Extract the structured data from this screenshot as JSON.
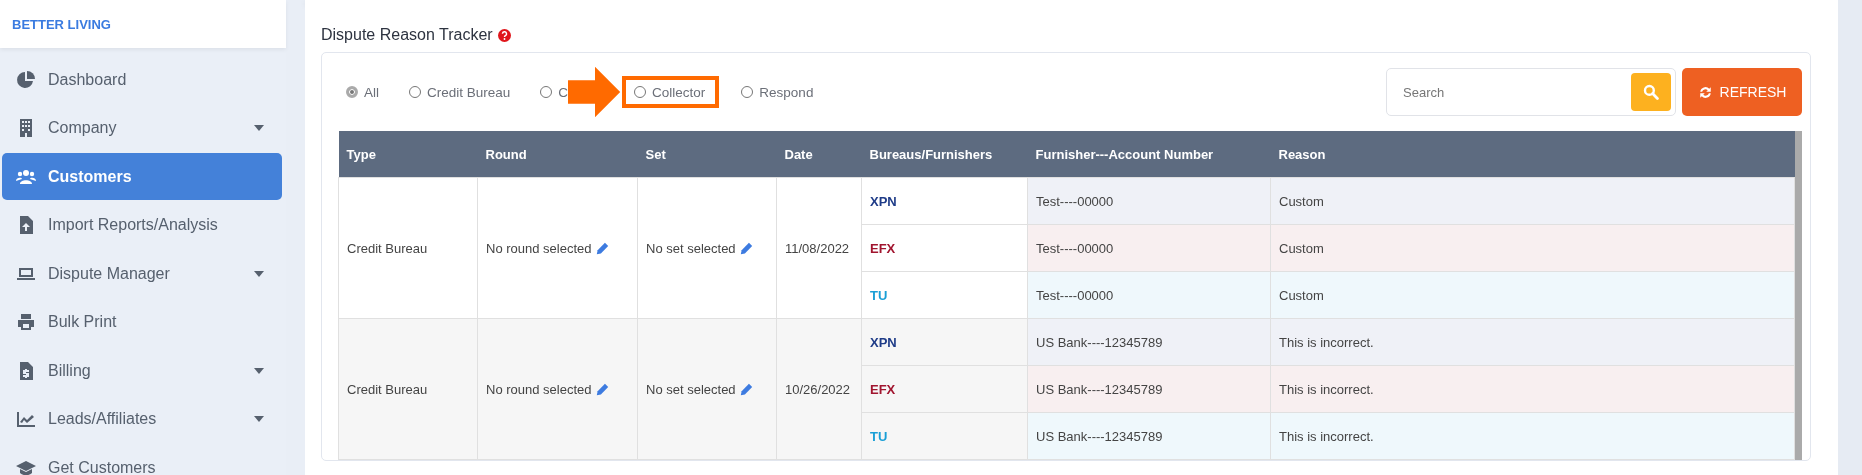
{
  "brand": "BETTER LIVING",
  "sidebar": {
    "items": [
      {
        "label": "Dashboard",
        "selected": false,
        "dropdown": false
      },
      {
        "label": "Company",
        "selected": false,
        "dropdown": true
      },
      {
        "label": "Customers",
        "selected": true,
        "dropdown": false
      },
      {
        "label": "Import Reports/Analysis",
        "selected": false,
        "dropdown": false
      },
      {
        "label": "Dispute Manager",
        "selected": false,
        "dropdown": true
      },
      {
        "label": "Bulk Print",
        "selected": false,
        "dropdown": false
      },
      {
        "label": "Billing",
        "selected": false,
        "dropdown": true
      },
      {
        "label": "Leads/Affiliates",
        "selected": false,
        "dropdown": true
      },
      {
        "label": "Get Customers",
        "selected": false,
        "dropdown": false
      }
    ]
  },
  "panel": {
    "title": "Dispute Reason Tracker",
    "filters": [
      {
        "label": "All",
        "selected": true,
        "highlighted": false
      },
      {
        "label": "Credit Bureau",
        "selected": false,
        "highlighted": false
      },
      {
        "label": "C",
        "selected": false,
        "highlighted": false
      },
      {
        "label": "Collector",
        "selected": false,
        "highlighted": true
      },
      {
        "label": "Respond",
        "selected": false,
        "highlighted": false
      }
    ],
    "search": {
      "placeholder": "Search"
    },
    "refresh_button": "REFRESH",
    "table": {
      "columns": [
        "Type",
        "Round",
        "Set",
        "Date",
        "Bureaus/Furnishers",
        "Furnisher---Account Number",
        "Reason"
      ],
      "groups": [
        {
          "type": "Credit Bureau",
          "round": "No round selected",
          "set": "No set selected",
          "date": "11/08/2022",
          "lines": [
            {
              "bureau": "XPN",
              "color": "#1f3c88",
              "account": "Test----00000",
              "reason": "Custom"
            },
            {
              "bureau": "EFX",
              "color": "#a1152f",
              "account": "Test----00000",
              "reason": "Custom"
            },
            {
              "bureau": "TU",
              "color": "#1a9fd6",
              "account": "Test----00000",
              "reason": "Custom"
            }
          ]
        },
        {
          "type": "Credit Bureau",
          "round": "No round selected",
          "set": "No set selected",
          "date": "10/26/2022",
          "lines": [
            {
              "bureau": "XPN",
              "color": "#1f3c88",
              "account": "US Bank----12345789",
              "reason": "This is incorrect."
            },
            {
              "bureau": "EFX",
              "color": "#a1152f",
              "account": "US Bank----12345789",
              "reason": "This is incorrect."
            },
            {
              "bureau": "TU",
              "color": "#1a9fd6",
              "account": "US Bank----12345789",
              "reason": "This is incorrect."
            }
          ]
        }
      ]
    }
  }
}
